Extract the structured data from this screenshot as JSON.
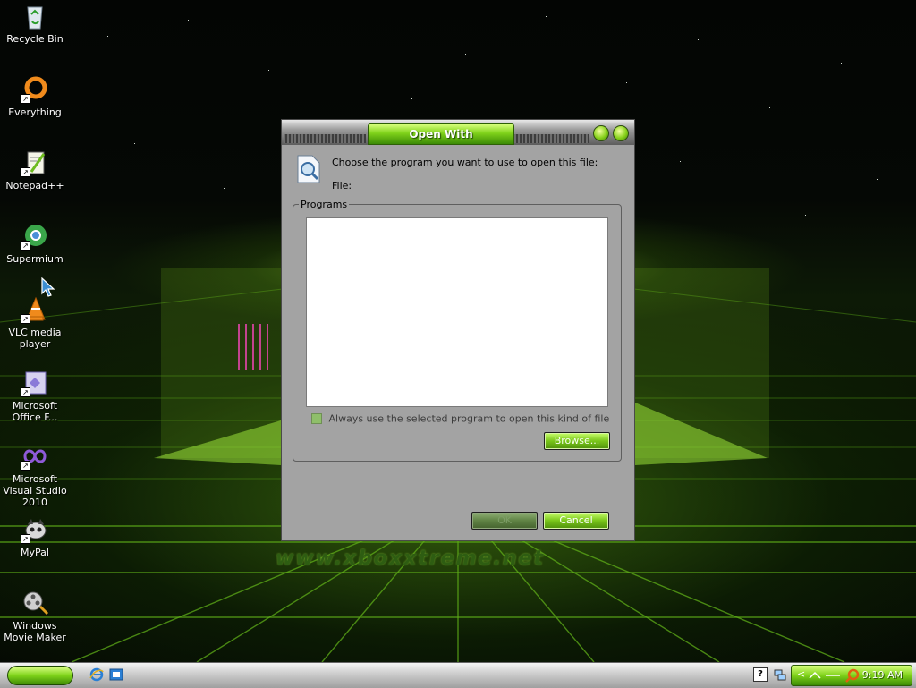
{
  "desktop": {
    "watermark": "www.xboxxtreme.net",
    "icons": [
      {
        "label": "Recycle Bin",
        "icon": "recycle-bin-icon"
      },
      {
        "label": "Everything",
        "icon": "everything-icon"
      },
      {
        "label": "Notepad++",
        "icon": "notepad-plus-plus-icon"
      },
      {
        "label": "Supermium",
        "icon": "supermium-icon"
      },
      {
        "label": "VLC media player",
        "icon": "vlc-icon"
      },
      {
        "label": "Microsoft Office F...",
        "icon": "office-icon"
      },
      {
        "label": "Microsoft Visual Studio 2010",
        "icon": "visual-studio-icon"
      },
      {
        "label": "MyPal",
        "icon": "mypal-icon"
      },
      {
        "label": "Windows Movie Maker",
        "icon": "movie-maker-icon"
      }
    ]
  },
  "dialog": {
    "title": "Open With",
    "prompt": "Choose the program you want to use to open this file:",
    "file_label": "File:",
    "programs_label": "Programs",
    "always_use_label": "Always use the selected program to open this kind of file",
    "always_use_checked": false,
    "browse_label": "Browse...",
    "ok_label": "OK",
    "cancel_label": "Cancel"
  },
  "taskbar": {
    "clock": "9:19 AM",
    "quick_launch": [
      "internet-explorer-icon",
      "outlook-express-icon"
    ],
    "tray_icons": [
      "help-icon",
      "network-icon",
      "search-icon"
    ]
  },
  "colors": {
    "accent_green": "#7fd21a",
    "dialog_gray": "#a3a3a3"
  }
}
